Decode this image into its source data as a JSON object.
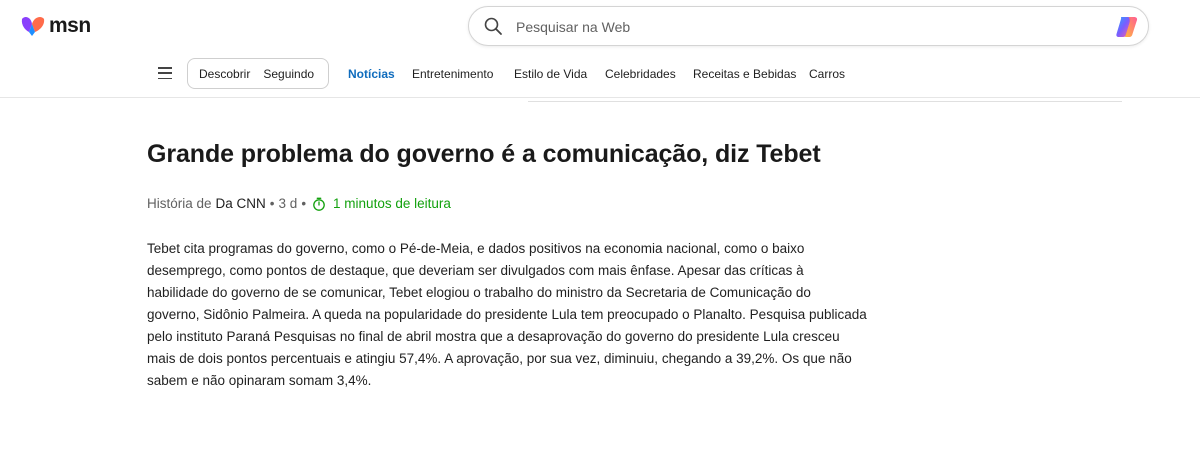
{
  "header": {
    "logo_text": "msn",
    "search_placeholder": "Pesquisar na Web"
  },
  "nav": {
    "pill_items": [
      "Descobrir",
      "Seguindo"
    ],
    "links": [
      "Notícias",
      "Entretenimento",
      "Estilo de Vida",
      "Celebridades",
      "Receitas e Bebidas",
      "Carros"
    ],
    "active_link": "Notícias"
  },
  "article": {
    "headline": "Grande problema do governo é a comunicação, diz Tebet",
    "byline_prefix": "História de",
    "source": "Da CNN",
    "age": "3 d",
    "read_time": "1 minutos de leitura",
    "body": "Tebet cita programas do governo, como o Pé-de-Meia, e dados positivos na economia nacional, como o baixo desemprego, como pontos de destaque, que deveriam ser divulgados com mais ênfase. Apesar das críticas à habilidade do governo de se comunicar, Tebet elogiou o trabalho do ministro da Secretaria de Comunicação do governo, Sidônio Palmeira. A queda na popularidade do presidente Lula tem preocupado o Planalto. Pesquisa publicada pelo instituto Paraná Pesquisas no final de abril mostra que a desaprovação do governo do presidente Lula cresceu mais de dois pontos percentuais e atingiu 57,4%. A aprovação, por sua vez, diminuiu, chegando a 39,2%. Os que não sabem e não opinaram somam 3,4%."
  },
  "colors": {
    "accent": "#0f6cbd",
    "read_time": "#13a10e"
  },
  "icons": [
    "msn-logo-icon",
    "search-icon",
    "copilot-icon",
    "hamburger-icon",
    "timer-icon"
  ]
}
